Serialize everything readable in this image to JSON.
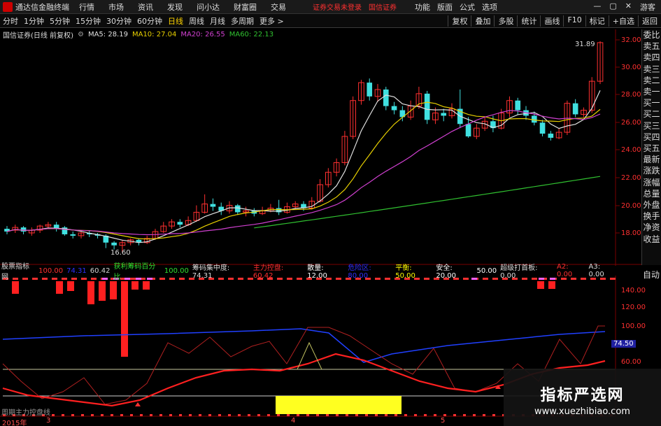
{
  "menubar": {
    "app_title": "通达信金融终端",
    "items": [
      "行情",
      "市场",
      "资讯",
      "发现",
      "问小达",
      "财富圈",
      "交易"
    ],
    "status": "证券交易未登录",
    "broker": "国信证券",
    "right_items": [
      "功能",
      "版面",
      "公式",
      "选项"
    ],
    "guest": "游客"
  },
  "toolbar": {
    "periods": [
      "分时",
      "1分钟",
      "5分钟",
      "15分钟",
      "30分钟",
      "60分钟",
      "日线",
      "周线",
      "月线",
      "多周期",
      "更多 >"
    ],
    "active_period": "日线",
    "right_buttons": [
      "复权",
      "叠加",
      "多股",
      "统计",
      "画线",
      "F10",
      "标记",
      "+自选",
      "返回"
    ]
  },
  "chart_header": {
    "stock": "国信证券(日线 前复权)",
    "ma": [
      {
        "label": "MA5: 28.19",
        "color": "#e0e0e0"
      },
      {
        "label": "MA10: 27.04",
        "color": "#e8d000"
      },
      {
        "label": "MA20: 26.55",
        "color": "#d040d0"
      },
      {
        "label": "MA60: 22.13",
        "color": "#30c030"
      }
    ]
  },
  "side_panel": [
    "委比",
    "卖五",
    "卖四",
    "卖三",
    "卖二",
    "卖一",
    "买一",
    "买二",
    "买三",
    "买四",
    "买五",
    "最新",
    "涨跌",
    "涨幅",
    "总量",
    "外盘",
    "换手",
    "净资",
    "收益"
  ],
  "side_auto": "自动",
  "price_axis": [
    "32.00",
    "30.00",
    "28.00",
    "26.00",
    "24.00",
    "22.00",
    "20.00",
    "18.00"
  ],
  "price_high_label": "31.89",
  "price_low_label": "16.60",
  "indicator_header": [
    {
      "text": "股票指标网",
      "color": "#dddddd"
    },
    {
      "text": "100.00",
      "color": "#ff3030"
    },
    {
      "text": "74.31",
      "color": "#3030ff"
    },
    {
      "text": "60.42",
      "color": "#d0d0d0"
    },
    {
      "text": "获利筹码百分比",
      "color": "#30e030"
    },
    {
      "text": "100.00",
      "color": "#30e030"
    },
    {
      "text": "筹码集中度: 74.31",
      "color": "#dddddd"
    },
    {
      "text": "主力控盘: 60.42",
      "color": "#ff3030"
    },
    {
      "text": "散量: 12.00",
      "color": "#ffffff"
    },
    {
      "text": "危险区: 80.00",
      "color": "#3030ff"
    },
    {
      "text": "平衡: 50.00",
      "color": "#ffff00"
    },
    {
      "text": "安全: 20.00",
      "color": "#ffffff"
    },
    {
      "text": "50.00",
      "color": "#ffffff"
    },
    {
      "text": "超级打首板: 0.00",
      "color": "#dddddd"
    },
    {
      "text": "A2: 0.00",
      "color": "#ff3030"
    },
    {
      "text": "A3: 0.00",
      "color": "#dddddd"
    }
  ],
  "ind_axis": [
    "140.00",
    "120.00",
    "100.00",
    "74.50",
    "60.00"
  ],
  "date_labels": [
    "2015年",
    "3",
    "4",
    "5"
  ],
  "bottom_caption": "周期主力控盘线",
  "watermark": {
    "title": "指标严选网",
    "url": "www.xuezhibiao.com"
  },
  "colors": {
    "up": "#ff3030",
    "down": "#40e0e0",
    "ma5": "#e0e0e0",
    "ma10": "#e8d000",
    "ma20": "#d040d0",
    "ma60": "#30c030"
  }
}
